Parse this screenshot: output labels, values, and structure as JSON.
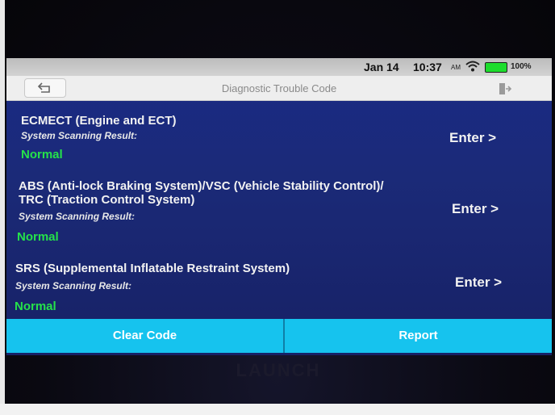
{
  "device": {
    "brand": "LAUNCH"
  },
  "status_bar": {
    "date": "Jan 14",
    "time": "10:37",
    "ampm": "AM",
    "battery": "100%"
  },
  "header": {
    "title": "Diagnostic Trouble Code",
    "back_icon": "back-arrow-icon",
    "exit_icon": "exit-icon"
  },
  "systems": [
    {
      "name_lines": [
        "ECMECT (Engine and ECT)"
      ],
      "scan_label": "System Scanning Result:",
      "result": "Normal",
      "enter_label": "Enter >"
    },
    {
      "name_lines": [
        "ABS (Anti-lock Braking System)/VSC (Vehicle Stability Control)/",
        "TRC (Traction Control System)"
      ],
      "scan_label": "System Scanning Result:",
      "result": "Normal",
      "enter_label": "Enter >"
    },
    {
      "name_lines": [
        "SRS (Supplemental Inflatable Restraint System)"
      ],
      "scan_label": "System Scanning Result:",
      "result": "Normal",
      "enter_label": "Enter >"
    }
  ],
  "footer": {
    "clear_code_label": "Clear Code",
    "report_label": "Report"
  },
  "colors": {
    "screen_bg": "#1a2b86",
    "result_green": "#25e24a",
    "button_bar": "#16c3ee"
  }
}
